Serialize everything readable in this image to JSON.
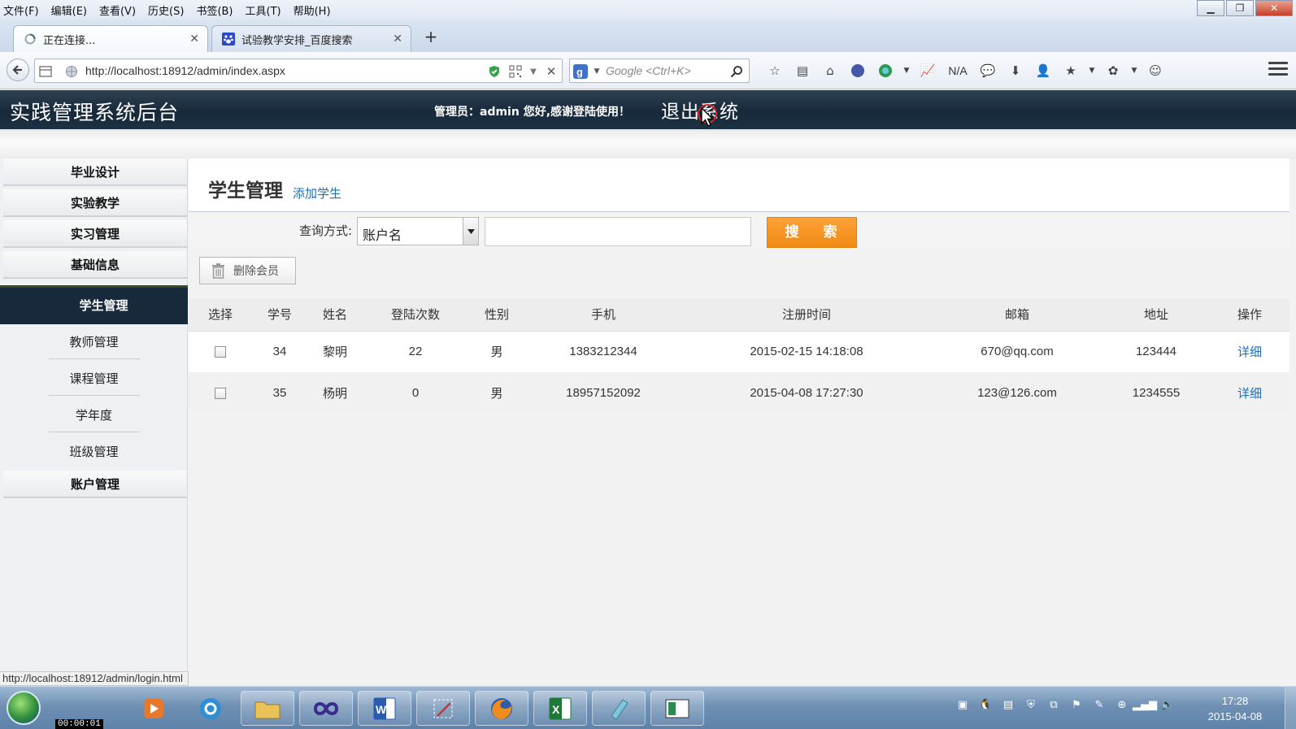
{
  "browser": {
    "menu": [
      "文件(F)",
      "编辑(E)",
      "查看(V)",
      "历史(S)",
      "书签(B)",
      "工具(T)",
      "帮助(H)"
    ],
    "tabs": [
      {
        "title": "正在连接...",
        "close": "✕"
      },
      {
        "title": "试验教学安排_百度搜索",
        "close": "✕"
      }
    ],
    "new_tab": "+",
    "url": "http://localhost:18912/admin/index.aspx",
    "search_placeholder": "Google <Ctrl+K>",
    "toolbar_text": "N/A",
    "status_url": "http://localhost:18912/admin/login.html"
  },
  "header": {
    "title": "实践管理系统后台",
    "greeting": "管理员：admin 您好,感谢登陆使用！",
    "logout": "退出系统"
  },
  "sidebar": {
    "categories": [
      "毕业设计",
      "实验教学",
      "实习管理",
      "基础信息"
    ],
    "active": "学生管理",
    "items": [
      "教师管理",
      "课程管理",
      "学年度",
      "班级管理"
    ],
    "bottom": "账户管理"
  },
  "content": {
    "title": "学生管理",
    "add_link": "添加学生",
    "search_label": "查询方式:",
    "search_field": "账户名",
    "search_value": "",
    "search_button": "搜 索",
    "delete_button": "删除会员"
  },
  "table": {
    "columns": [
      "选择",
      "学号",
      "姓名",
      "登陆次数",
      "性别",
      "手机",
      "注册时间",
      "邮箱",
      "地址",
      "操作"
    ],
    "rows": [
      {
        "id": "34",
        "name": "黎明",
        "logins": "22",
        "gender": "男",
        "phone": "1383212344",
        "registered": "2015-02-15 14:18:08",
        "email": "670@qq.com",
        "address": "123444",
        "action": "详细"
      },
      {
        "id": "35",
        "name": "杨明",
        "logins": "0",
        "gender": "男",
        "phone": "18957152092",
        "registered": "2015-04-08 17:27:30",
        "email": "123@126.com",
        "address": "1234555",
        "action": "详细"
      }
    ]
  },
  "taskbar": {
    "time": "17:28",
    "date": "2015-04-08",
    "recording_timer": "00:00:01"
  },
  "colors": {
    "header_bg": "#17293a",
    "search_button": "#f39221",
    "link": "#1a6fc4"
  }
}
